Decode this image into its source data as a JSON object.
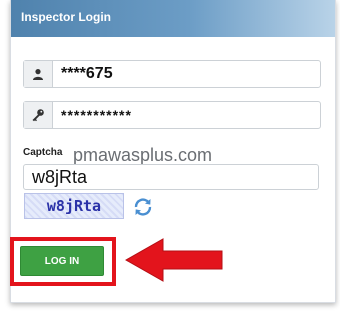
{
  "panel": {
    "title": "Inspector Login"
  },
  "username": {
    "icon": "user-icon",
    "value": "****675"
  },
  "password": {
    "icon": "key-icon",
    "value": "***********"
  },
  "captcha": {
    "label": "Captcha",
    "input_value": "w8jRta",
    "image_text": "w8jRta",
    "refresh_icon": "refresh-icon"
  },
  "watermark": "pmawasplus.com",
  "login_button": {
    "label": "LOG IN"
  },
  "annotation": {
    "arrow_icon": "left-arrow-icon",
    "color": "#e3141c"
  },
  "colors": {
    "button": "#3ea143",
    "header": "#4f82ad",
    "accent": "#e3141c"
  }
}
